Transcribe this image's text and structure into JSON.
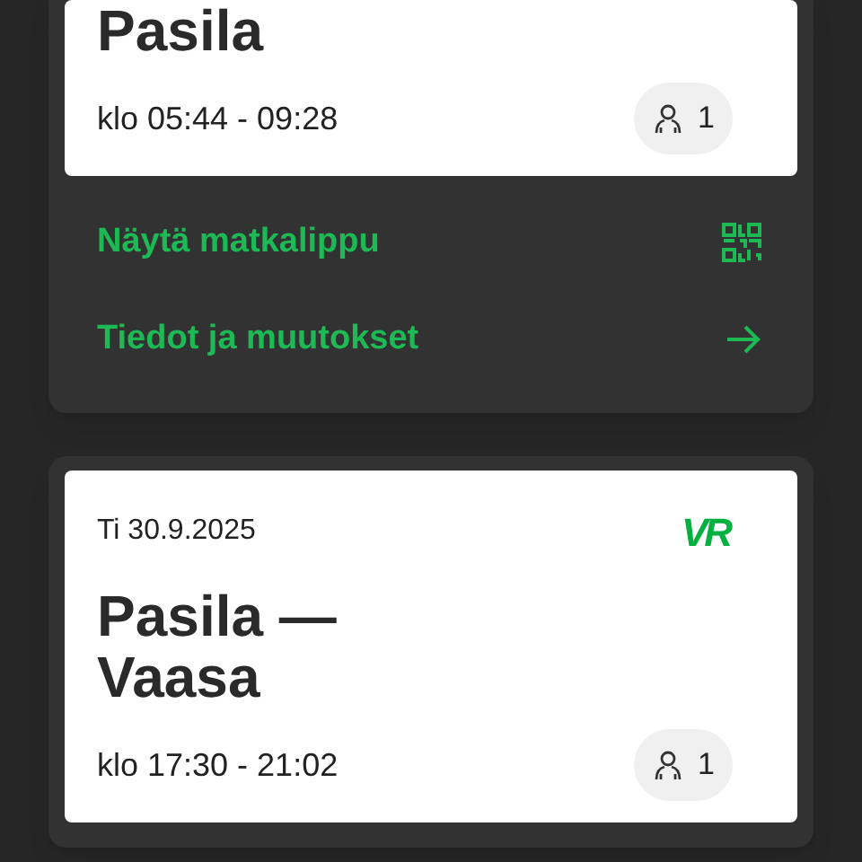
{
  "trips": [
    {
      "title": "Pasila",
      "time": "klo 05:44 - 09:28",
      "passengers": "1",
      "actions": [
        {
          "label": "Näytä matkalippu",
          "kind": "qr"
        },
        {
          "label": "Tiedot ja muutokset",
          "kind": "arrow"
        }
      ]
    },
    {
      "date": "Ti 30.9.2025",
      "logo": "VR",
      "title": "Pasila —\nVaasa",
      "time": "klo 17:30 - 21:02",
      "passengers": "1"
    }
  ]
}
